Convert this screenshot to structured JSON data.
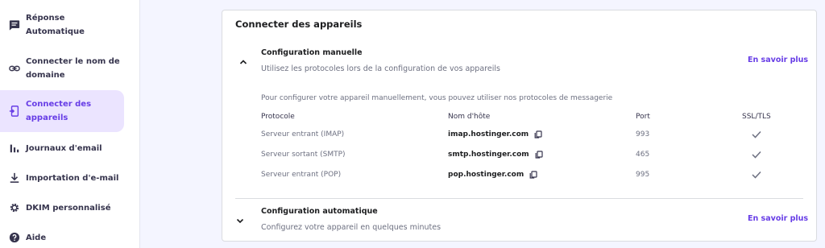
{
  "sidebar": {
    "items": [
      {
        "label": "Réponse Automatique",
        "icon": "message-reply-icon",
        "active": false
      },
      {
        "label": "Connecter le nom de domaine",
        "icon": "link-icon",
        "active": false
      },
      {
        "label": "Connecter des appareils",
        "icon": "device-connect-icon",
        "active": true
      },
      {
        "label": "Journaux d'email",
        "icon": "bar-chart-icon",
        "active": false
      },
      {
        "label": "Importation d'e-mail",
        "icon": "download-icon",
        "active": false
      },
      {
        "label": "DKIM personnalisé",
        "icon": "gear-icon",
        "active": false
      },
      {
        "label": "Aide",
        "icon": "help-icon",
        "active": false
      }
    ]
  },
  "card": {
    "title": "Connecter des appareils",
    "manual": {
      "title": "Configuration manuelle",
      "subtitle": "Utilisez les protocoles lors de la configuration de vos appareils",
      "link": "En savoir plus",
      "intro": "Pour configurer votre appareil manuellement, vous pouvez utiliser nos protocoles de messagerie",
      "columns": [
        "Protocole",
        "Nom d'hôte",
        "Port",
        "SSL/TLS"
      ],
      "rows": [
        {
          "protocol": "Serveur entrant (IMAP)",
          "host": "imap.hostinger.com",
          "port": "993",
          "ssl": true
        },
        {
          "protocol": "Serveur sortant (SMTP)",
          "host": "smtp.hostinger.com",
          "port": "465",
          "ssl": true
        },
        {
          "protocol": "Serveur entrant (POP)",
          "host": "pop.hostinger.com",
          "port": "995",
          "ssl": true
        }
      ]
    },
    "auto": {
      "title": "Configuration automatique",
      "subtitle": "Configurez votre appareil en quelques minutes",
      "link": "En savoir plus"
    }
  },
  "colors": {
    "accent": "#673de6",
    "active_bg": "#ebe4ff",
    "page_bg": "#f4f5ff"
  }
}
